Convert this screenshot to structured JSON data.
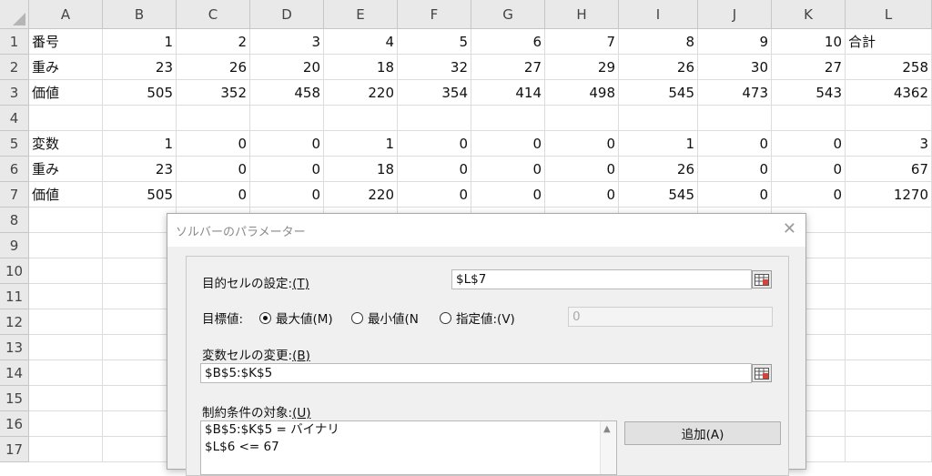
{
  "columns": [
    "A",
    "B",
    "C",
    "D",
    "E",
    "F",
    "G",
    "H",
    "I",
    "J",
    "K",
    "L"
  ],
  "rows": [
    "1",
    "2",
    "3",
    "4",
    "5",
    "6",
    "7",
    "8",
    "9",
    "10",
    "11",
    "12",
    "13",
    "14",
    "15",
    "16",
    "17"
  ],
  "cells": [
    [
      "番号",
      "1",
      "2",
      "3",
      "4",
      "5",
      "6",
      "7",
      "8",
      "9",
      "10",
      "合計"
    ],
    [
      "重み",
      "23",
      "26",
      "20",
      "18",
      "32",
      "27",
      "29",
      "26",
      "30",
      "27",
      "258"
    ],
    [
      "価値",
      "505",
      "352",
      "458",
      "220",
      "354",
      "414",
      "498",
      "545",
      "473",
      "543",
      "4362"
    ],
    [
      "",
      "",
      "",
      "",
      "",
      "",
      "",
      "",
      "",
      "",
      "",
      ""
    ],
    [
      "変数",
      "1",
      "0",
      "0",
      "1",
      "0",
      "0",
      "0",
      "1",
      "0",
      "0",
      "3"
    ],
    [
      "重み",
      "23",
      "0",
      "0",
      "18",
      "0",
      "0",
      "0",
      "26",
      "0",
      "0",
      "67"
    ],
    [
      "価値",
      "505",
      "0",
      "0",
      "220",
      "0",
      "0",
      "0",
      "545",
      "0",
      "0",
      "1270"
    ]
  ],
  "dialog": {
    "title": "ソルバーのパラメーター",
    "close_symbol": "✕",
    "objective_label": "目的セルの設定:",
    "objective_key": "(T)",
    "objective_value": "$L$7",
    "target_label": "目標値:",
    "radio_max": "最大値(M)",
    "radio_min": "最小値(N",
    "radio_value": "指定値:(V)",
    "value_field": "0",
    "changing_label": "変数セルの変更:",
    "changing_key": "(B)",
    "changing_value": "$B$5:$K$5",
    "constraints_label": "制約条件の対象:",
    "constraints_key": "(U)",
    "constraints": [
      "$B$5:$K$5 = バイナリ",
      "$L$6 <= 67"
    ],
    "add_button": "追加(A)",
    "scroll_up_symbol": "▲"
  }
}
